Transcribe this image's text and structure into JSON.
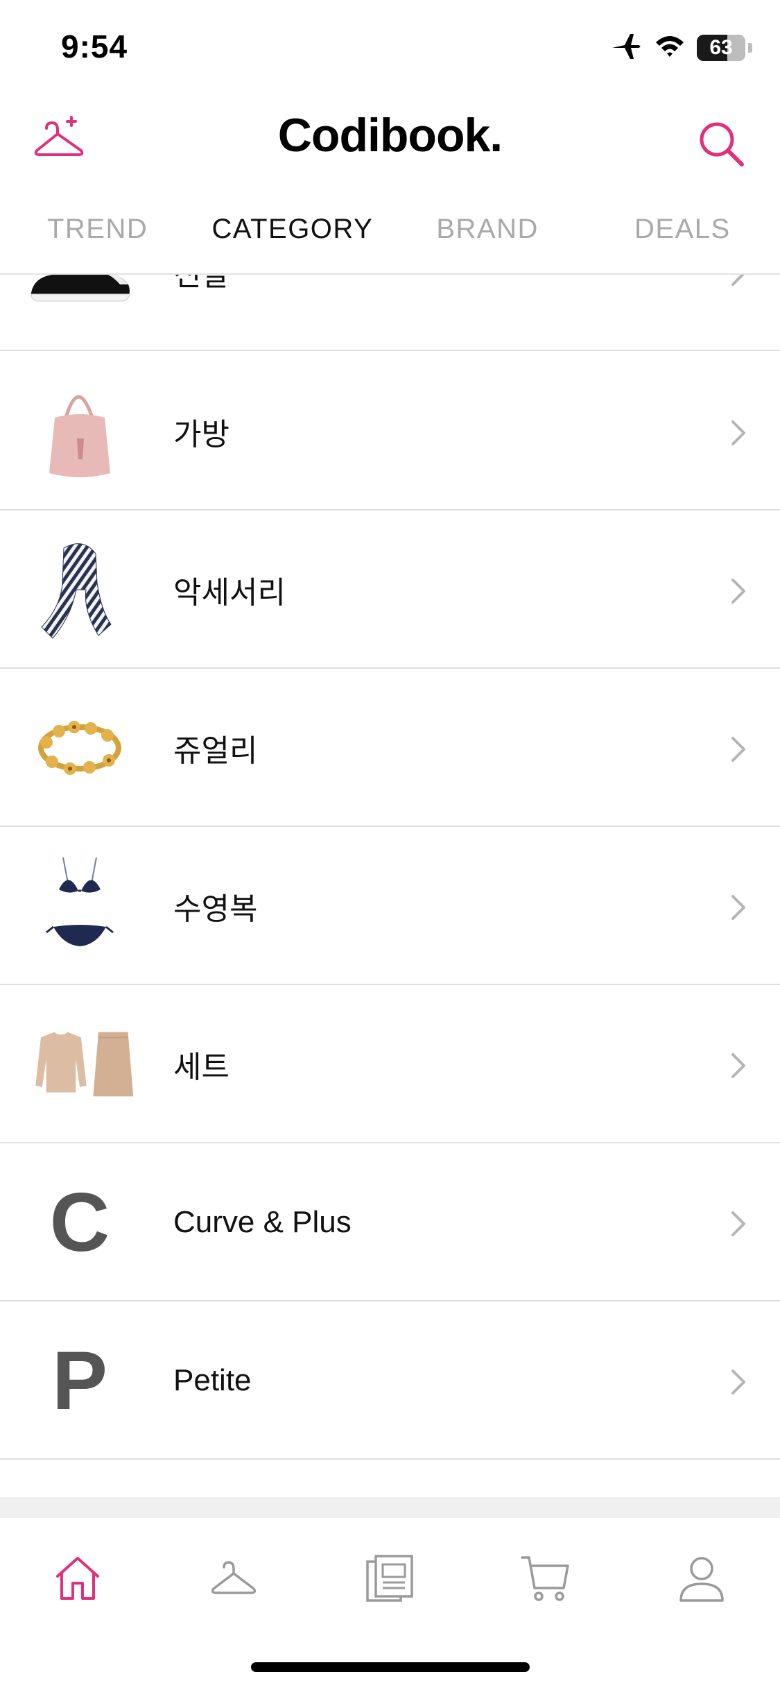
{
  "status_bar": {
    "time": "9:54",
    "battery_level": "63",
    "battery_fraction": 0.63,
    "icons": [
      "airplane-icon",
      "wifi-icon",
      "battery-icon"
    ]
  },
  "header": {
    "logo": "Codibook.",
    "left_icon": "hanger-plus-icon",
    "right_icon": "search-icon",
    "accent_color": "#e0307a"
  },
  "tabs": [
    {
      "label": "TREND",
      "active": false
    },
    {
      "label": "CATEGORY",
      "active": true
    },
    {
      "label": "BRAND",
      "active": false
    },
    {
      "label": "DEALS",
      "active": false
    }
  ],
  "categories": [
    {
      "label": "신발",
      "thumb": "sneaker-image"
    },
    {
      "label": "가방",
      "thumb": "pink-bag-image"
    },
    {
      "label": "악세서리",
      "thumb": "striped-scarf-image"
    },
    {
      "label": "쥬얼리",
      "thumb": "gold-bracelet-image"
    },
    {
      "label": "수영복",
      "thumb": "navy-bikini-image"
    },
    {
      "label": "세트",
      "thumb": "beige-set-image"
    },
    {
      "label": "Curve & Plus",
      "thumb_letter": "C"
    },
    {
      "label": "Petite",
      "thumb_letter": "P"
    }
  ],
  "bottom_nav": [
    {
      "icon": "home-icon",
      "active": true
    },
    {
      "icon": "hanger-icon",
      "active": false
    },
    {
      "icon": "lookbook-icon",
      "active": false
    },
    {
      "icon": "cart-icon",
      "active": false
    },
    {
      "icon": "profile-icon",
      "active": false
    }
  ]
}
